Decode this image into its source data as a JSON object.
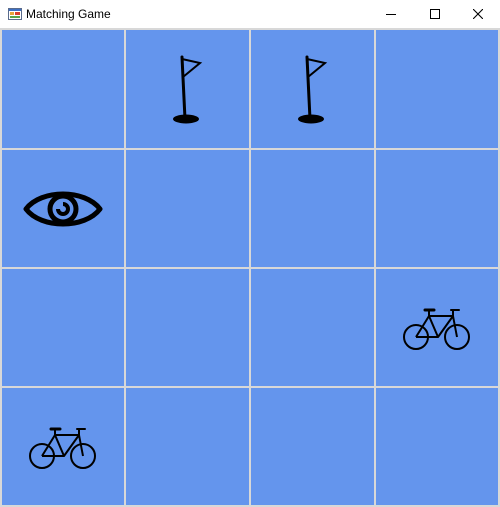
{
  "window": {
    "title": "Matching Game",
    "app_icon": "windows-form-icon",
    "controls": [
      "minimize-icon",
      "maximize-icon",
      "close-icon"
    ]
  },
  "board": {
    "background_color": "#6495ed",
    "grid_color": "#d8d8d8",
    "rows": 4,
    "columns": 4,
    "cells": [
      {
        "row": 1,
        "col": 1,
        "icon": null
      },
      {
        "row": 1,
        "col": 2,
        "icon": "golf-flag-icon"
      },
      {
        "row": 1,
        "col": 3,
        "icon": "golf-flag-icon"
      },
      {
        "row": 1,
        "col": 4,
        "icon": null
      },
      {
        "row": 2,
        "col": 1,
        "icon": "eye-icon"
      },
      {
        "row": 2,
        "col": 2,
        "icon": null
      },
      {
        "row": 2,
        "col": 3,
        "icon": null
      },
      {
        "row": 2,
        "col": 4,
        "icon": null
      },
      {
        "row": 3,
        "col": 1,
        "icon": null
      },
      {
        "row": 3,
        "col": 2,
        "icon": null
      },
      {
        "row": 3,
        "col": 3,
        "icon": null
      },
      {
        "row": 3,
        "col": 4,
        "icon": "bicycle-icon"
      },
      {
        "row": 4,
        "col": 1,
        "icon": "bicycle-icon"
      },
      {
        "row": 4,
        "col": 2,
        "icon": null
      },
      {
        "row": 4,
        "col": 3,
        "icon": null
      },
      {
        "row": 4,
        "col": 4,
        "icon": null
      }
    ]
  }
}
